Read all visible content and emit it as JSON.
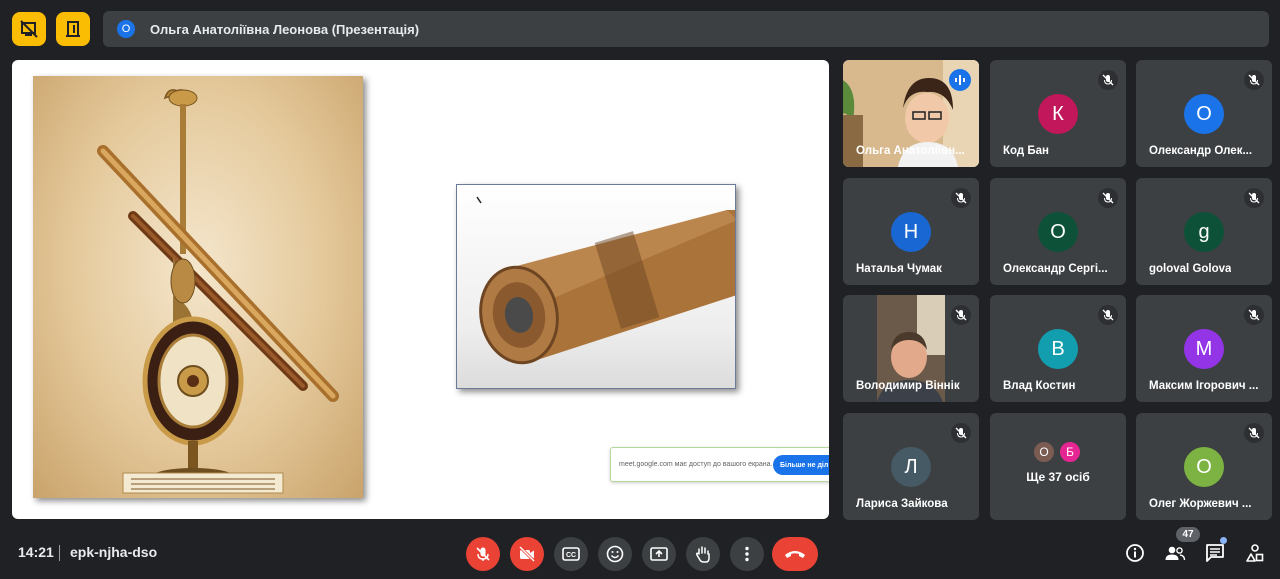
{
  "presenter": {
    "avatar_initial": "О",
    "name": "Ольга Анатоліївна Леонова (Презентація)"
  },
  "share_notice": {
    "text": "meet.google.com має доступ до вашого екрана.",
    "button_label": "Більше не діл"
  },
  "participants": [
    {
      "name": "Ольга Анатоліївн...",
      "type": "video",
      "speaking": true
    },
    {
      "name": "Код Бан",
      "initial": "К",
      "color": "#c2185b",
      "muted": true
    },
    {
      "name": "Олександр Олек...",
      "initial": "О",
      "color": "#1a73e8",
      "muted": true
    },
    {
      "name": "Наталья Чумак",
      "initial": "Н",
      "color": "#1967d2",
      "muted": true
    },
    {
      "name": "Олександр Сергі...",
      "initial": "О",
      "color": "#0d5238",
      "muted": true
    },
    {
      "name": "goloval Golova",
      "initial": "g",
      "color": "#0d5238",
      "muted": true
    },
    {
      "name": "Володимир Віннік",
      "type": "video",
      "muted": true
    },
    {
      "name": "Влад Костин",
      "initial": "В",
      "color": "#129eaf",
      "muted": true
    },
    {
      "name": "Максим Ігорович ...",
      "initial": "М",
      "color": "#9334e6",
      "muted": true
    },
    {
      "name": "Лариса Зайкова",
      "initial": "Л",
      "color": "#455a64",
      "muted": true
    },
    {
      "name": "Ще 37 осіб",
      "type": "more",
      "initials": [
        "О",
        "Б"
      ],
      "colors": [
        "#7b5c53",
        "#e52592"
      ]
    },
    {
      "name": "Олег Жоржевич ...",
      "initial": "О",
      "color": "#7cb342",
      "muted": true
    }
  ],
  "footer": {
    "time": "14:21",
    "meeting_code": "epk-njha-dso",
    "people_count": "47",
    "controls": [
      "mic-off",
      "camera-off",
      "captions",
      "emoji",
      "present",
      "raise-hand",
      "more-options",
      "leave-call"
    ],
    "right_icons": [
      "info",
      "people",
      "chat",
      "activities"
    ]
  },
  "colors": {
    "accent": "#1a73e8",
    "danger": "#ea4335",
    "toolbar_yellow": "#fbbc04",
    "background": "#202124",
    "tile": "#3c4043"
  }
}
